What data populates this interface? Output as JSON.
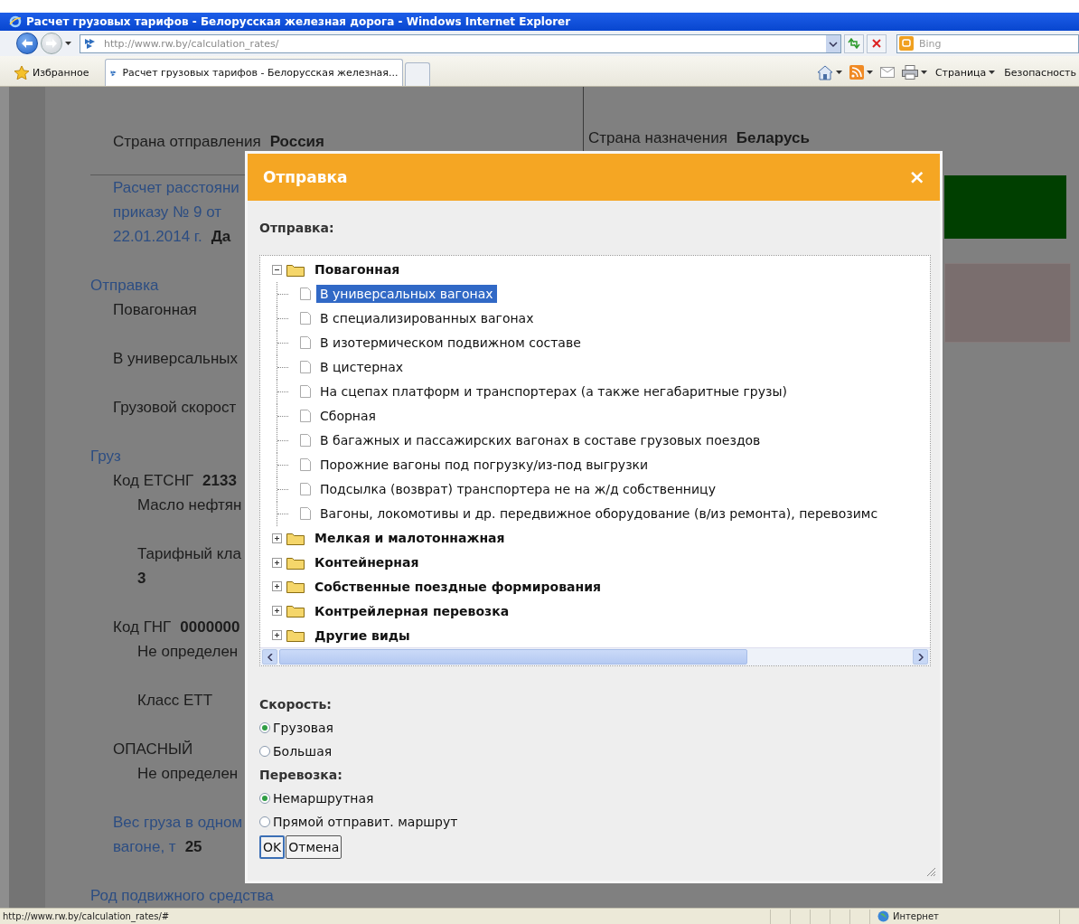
{
  "browser": {
    "title": "Расчет грузовых тарифов - Белорусская железная дорога - Windows Internet Explorer",
    "address": "http://www.rw.by/calculation_rates/",
    "search_placeholder": "Bing",
    "favorites": "Избранное",
    "tabs": [
      {
        "label": "Расчет грузовых тарифов - Белорусская железная...",
        "selected": true
      }
    ],
    "commands": [
      "Страница",
      "Безопасность"
    ]
  },
  "page": {
    "origin": {
      "label": "Страна отправления",
      "value": "Россия"
    },
    "destination": {
      "label": "Страна назначения",
      "value": "Беларусь"
    },
    "groups": [
      [
        {
          "kind": "link",
          "text": "Расчет расстояни"
        },
        {
          "kind": "link",
          "text": "приказу № 9 от"
        },
        {
          "kind": "link",
          "text": "22.01.2014 г.",
          "value": "Да"
        }
      ],
      [
        {
          "kind": "section",
          "text": "Отправка"
        },
        {
          "kind": "pair",
          "text": "Повагонная"
        }
      ],
      [
        {
          "kind": "pair",
          "text": "В универсальных"
        }
      ],
      [
        {
          "kind": "pair",
          "text": "Грузовой скорост"
        }
      ],
      [
        {
          "kind": "section",
          "text": "Груз"
        },
        {
          "kind": "pair",
          "text": "Код ЕТСНГ",
          "value": "2133"
        },
        {
          "kind": "sub",
          "text": "Масло нефтян"
        }
      ],
      [
        {
          "kind": "sub",
          "text": "Тарифный кла"
        },
        {
          "kind": "sub_value",
          "text": "3"
        }
      ],
      [
        {
          "kind": "pair",
          "text": "Код ГНГ",
          "value": "0000000"
        },
        {
          "kind": "sub",
          "text": "Не определен"
        }
      ],
      [
        {
          "kind": "sub",
          "text": "Класс ЕТТ"
        }
      ],
      [
        {
          "kind": "pair",
          "text": "ОПАСНЫЙ"
        },
        {
          "kind": "sub",
          "text": "Не определен"
        }
      ],
      [
        {
          "kind": "link",
          "text": "Вес груза в одном"
        },
        {
          "kind": "link",
          "text": "вагоне, т",
          "value": "25"
        }
      ],
      [
        {
          "kind": "section",
          "text": "Род подвижного средства"
        }
      ]
    ]
  },
  "dialog": {
    "title": "Отправка",
    "close": "×",
    "label": "Отправка:",
    "tree": [
      {
        "label": "Повагонная",
        "expanded": true,
        "selected": false,
        "children": [
          {
            "label": "В универсальных вагонах",
            "selected": true
          },
          {
            "label": "В специализированных вагонах",
            "selected": false
          },
          {
            "label": "В изотермическом подвижном составе",
            "selected": false
          },
          {
            "label": "В цистернах",
            "selected": false
          },
          {
            "label": "На сцепах платформ и транспортерах (а также негабаритные грузы)",
            "selected": false
          },
          {
            "label": "Сборная",
            "selected": false
          },
          {
            "label": "В багажных и пассажирских вагонах в составе грузовых поездов",
            "selected": false
          },
          {
            "label": "Порожние вагоны под погрузку/из-под выгрузки",
            "selected": false
          },
          {
            "label": "Подсылка (возврат) транспортера не на ж/д собственницу",
            "selected": false
          },
          {
            "label": "Вагоны, локомотивы и др. передвижное оборудование (в/из ремонта), перевозимс",
            "selected": false
          }
        ]
      },
      {
        "label": "Мелкая и малотоннажная",
        "expanded": false,
        "selected": false
      },
      {
        "label": "Контейнерная",
        "expanded": false,
        "selected": false
      },
      {
        "label": "Собственные поездные формирования",
        "expanded": false,
        "selected": false
      },
      {
        "label": "Контрейлерная перевозка",
        "expanded": false,
        "selected": false
      },
      {
        "label": "Другие виды",
        "expanded": false,
        "selected": false
      }
    ],
    "radio_groups": [
      {
        "label": "Скорость:",
        "options": [
          {
            "label": "Грузовая",
            "selected": true
          },
          {
            "label": "Большая",
            "selected": false
          }
        ]
      },
      {
        "label": "Перевозка:",
        "options": [
          {
            "label": "Немаршрутная",
            "selected": true
          },
          {
            "label": "Прямой отправит. маршрут",
            "selected": false
          }
        ]
      }
    ],
    "buttons": [
      {
        "label": "OK",
        "focused": true
      },
      {
        "label": "Отмена",
        "focused": false
      }
    ]
  },
  "status_bar": {
    "url": "http://www.rw.by/calculation_rates/#",
    "zone": "Интернет"
  }
}
